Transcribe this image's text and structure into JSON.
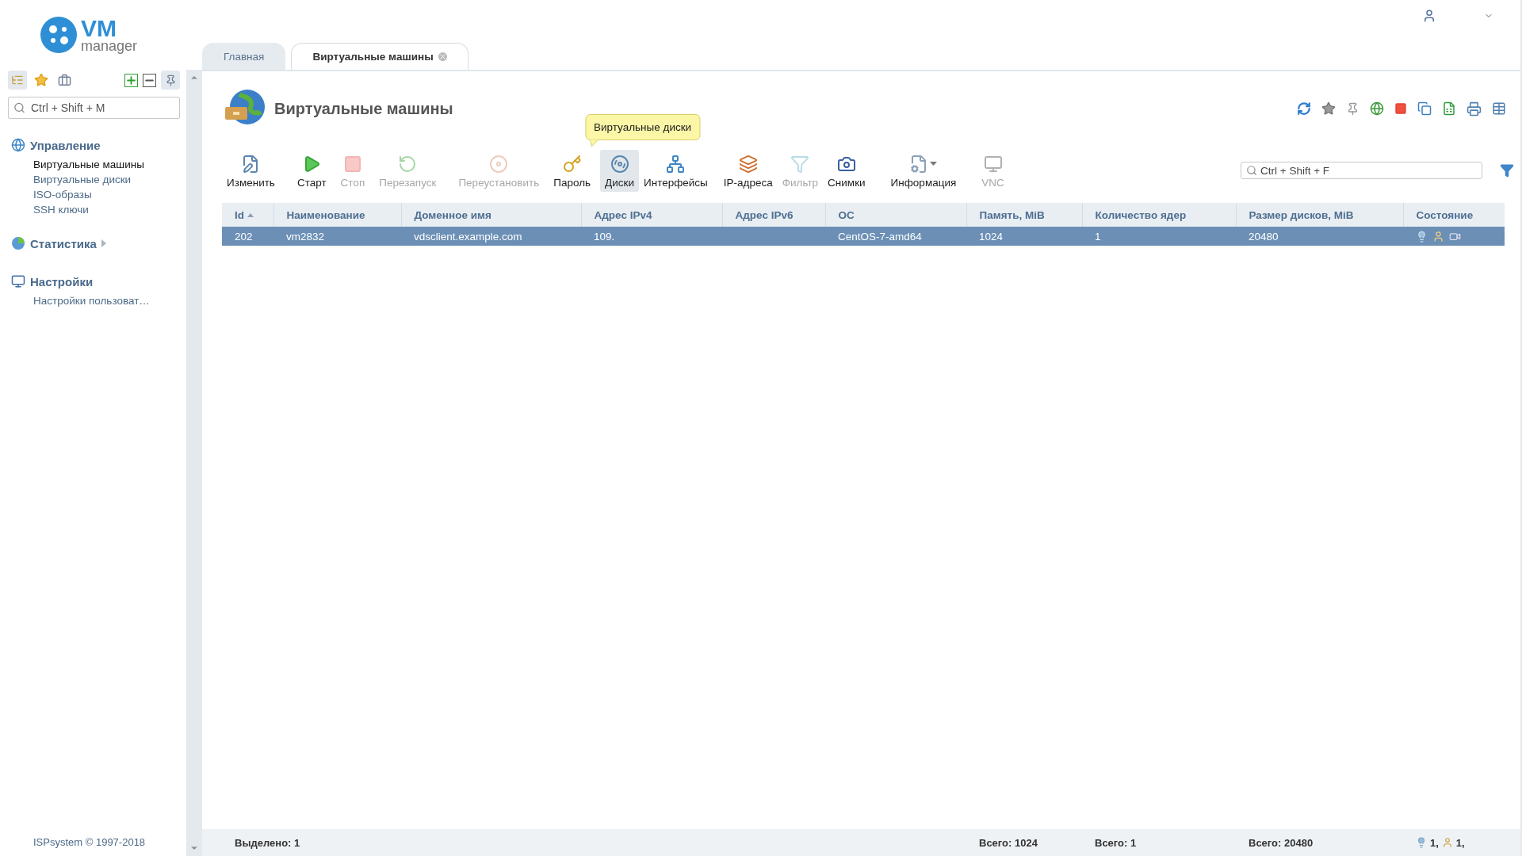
{
  "logo": {
    "title": "VM",
    "subtitle": "manager"
  },
  "sidebar": {
    "search": {
      "placeholder": "Ctrl + Shift + M"
    },
    "groups": [
      {
        "title": "Управление",
        "expanded": true,
        "items": [
          {
            "label": "Виртуальные машины",
            "selected": true
          },
          {
            "label": "Виртуальные диски",
            "selected": false
          },
          {
            "label": "ISO-образы",
            "selected": false
          },
          {
            "label": "SSH ключи",
            "selected": false
          }
        ]
      },
      {
        "title": "Статистика",
        "expanded": false
      },
      {
        "title": "Настройки",
        "expanded": true,
        "items": [
          {
            "label": "Настройки пользоват…",
            "selected": false
          }
        ]
      }
    ],
    "footer": "ISPsystem © 1997-2018"
  },
  "tabs": [
    {
      "label": "Главная",
      "selected": false,
      "closable": false
    },
    {
      "label": "Виртуальные машины",
      "selected": true,
      "closable": true
    }
  ],
  "page": {
    "title": "Виртуальные машины"
  },
  "toolbar": {
    "buttons": [
      {
        "label": "Изменить",
        "disabled": false,
        "selected": false,
        "dropdown": false
      },
      {
        "label": "Старт",
        "disabled": false,
        "selected": false,
        "dropdown": false
      },
      {
        "label": "Стоп",
        "disabled": true,
        "selected": false,
        "dropdown": false
      },
      {
        "label": "Перезапуск",
        "disabled": true,
        "selected": false,
        "dropdown": false
      },
      {
        "label": "Переустановить",
        "disabled": true,
        "selected": false,
        "dropdown": false
      },
      {
        "label": "Пароль",
        "disabled": false,
        "selected": false,
        "dropdown": false
      },
      {
        "label": "Диски",
        "disabled": false,
        "selected": true,
        "dropdown": false,
        "tooltip": "Виртуальные диски"
      },
      {
        "label": "Интерфейсы",
        "disabled": false,
        "selected": false,
        "dropdown": false
      },
      {
        "label": "IP-адреса",
        "disabled": false,
        "selected": false,
        "dropdown": false
      },
      {
        "label": "Фильтр",
        "disabled": true,
        "selected": false,
        "dropdown": false
      },
      {
        "label": "Снимки",
        "disabled": false,
        "selected": false,
        "dropdown": false
      },
      {
        "label": "Информация",
        "disabled": false,
        "selected": false,
        "dropdown": true
      },
      {
        "label": "VNC",
        "disabled": true,
        "selected": false,
        "dropdown": false
      }
    ],
    "search": {
      "placeholder": "Ctrl + Shift + F"
    }
  },
  "table": {
    "columns": [
      {
        "label": "Id",
        "sorted": true
      },
      {
        "label": "Наименование",
        "sorted": false
      },
      {
        "label": "Доменное имя",
        "sorted": false
      },
      {
        "label": "Адрес IPv4",
        "sorted": false
      },
      {
        "label": "Адрес IPv6",
        "sorted": false
      },
      {
        "label": "ОС",
        "sorted": false
      },
      {
        "label": "Память, MiB",
        "sorted": false
      },
      {
        "label": "Количество ядер",
        "sorted": false
      },
      {
        "label": "Размер дисков, MiB",
        "sorted": false
      },
      {
        "label": "Состояние",
        "sorted": false
      }
    ],
    "rows": [
      {
        "selected": true,
        "cells": [
          "202",
          "vm2832",
          "vdsclient.example.com",
          "109.",
          "",
          "CentOS-7-amd64",
          "1024",
          "1",
          "20480"
        ]
      }
    ]
  },
  "status_bar": {
    "selected": "Выделено: 1",
    "totals": [
      "Всего: 1024",
      "Всего: 1",
      "Всего: 20480"
    ],
    "counts": [
      "1,",
      "1,"
    ]
  }
}
